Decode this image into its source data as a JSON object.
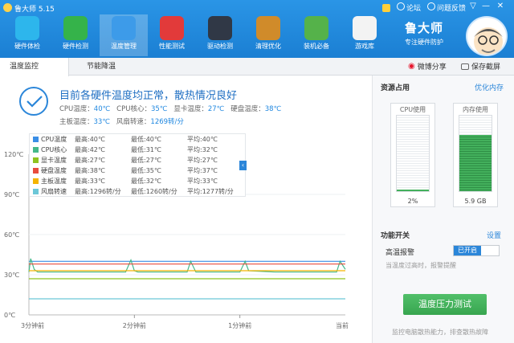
{
  "app": {
    "title": "鲁大师 5.15"
  },
  "top_links": {
    "forum": "论坛",
    "feedback": "问题反馈"
  },
  "toolbar": [
    {
      "label": "硬件体检",
      "icon": "monitor-icon",
      "color": "#2db6ec"
    },
    {
      "label": "硬件检测",
      "icon": "chip-icon",
      "color": "#35b34a"
    },
    {
      "label": "温度管理",
      "icon": "thermometer-chart-icon",
      "color": "#3d9be9"
    },
    {
      "label": "性能测试",
      "icon": "speedometer-icon",
      "color": "#e23a3a"
    },
    {
      "label": "驱动检测",
      "icon": "gear-icon",
      "color": "#303846"
    },
    {
      "label": "清理优化",
      "icon": "broom-icon",
      "color": "#d08b2a"
    },
    {
      "label": "装机必备",
      "icon": "box-icon",
      "color": "#55b24a"
    },
    {
      "label": "游戏库",
      "icon": "gamepad-icon",
      "color": "#f3f3f3"
    }
  ],
  "brand": {
    "name": "鲁大师",
    "subtitle": "专注硬件防护"
  },
  "tabs": [
    {
      "label": "温度监控",
      "active": true
    },
    {
      "label": "节能降温",
      "active": false
    }
  ],
  "actions": {
    "weibo_share": "微博分享",
    "save_screenshot": "保存截屏"
  },
  "summary": {
    "title": "目前各硬件温度均正常，散热情况良好",
    "metrics_row1": [
      {
        "label": "CPU温度：",
        "value": "40℃"
      },
      {
        "label": "CPU核心：",
        "value": "35℃"
      },
      {
        "label": "显卡温度：",
        "value": "27℃"
      },
      {
        "label": "硬盘温度：",
        "value": "38℃"
      }
    ],
    "metrics_row2": [
      {
        "label": "主板温度：",
        "value": "33℃"
      },
      {
        "label": "风扇转速：",
        "value": "1269转/分"
      }
    ]
  },
  "legend": [
    {
      "name": "CPU温度",
      "max": "最高:40℃",
      "min": "最低:40℃",
      "avg": "平均:40℃",
      "color": "#3a8ee6"
    },
    {
      "name": "CPU核心",
      "max": "最高:42℃",
      "min": "最低:31℃",
      "avg": "平均:32℃",
      "color": "#44b88a"
    },
    {
      "name": "显卡温度",
      "max": "最高:27℃",
      "min": "最低:27℃",
      "avg": "平均:27℃",
      "color": "#8fc31f"
    },
    {
      "name": "硬盘温度",
      "max": "最高:38℃",
      "min": "最低:35℃",
      "avg": "平均:37℃",
      "color": "#e84c3d"
    },
    {
      "name": "主板温度",
      "max": "最高:33℃",
      "min": "最低:32℃",
      "avg": "平均:33℃",
      "color": "#f5b400"
    },
    {
      "name": "风扇转速",
      "max": "最高:1296转/分",
      "min": "最低:1260转/分",
      "avg": "平均:1277转/分",
      "color": "#6cc7d8"
    }
  ],
  "chart_data": {
    "type": "line",
    "y_ticks": [
      "120℃",
      "90℃",
      "60℃",
      "30℃",
      "0℃"
    ],
    "x_ticks": [
      "3分钟前",
      "2分钟前",
      "1分钟前",
      "当前"
    ],
    "ylim": [
      0,
      120
    ],
    "x_range": [
      -180,
      0
    ],
    "series": [
      {
        "name": "CPU温度",
        "color": "#3a8ee6",
        "x": [
          -180,
          0
        ],
        "values": [
          40,
          40
        ]
      },
      {
        "name": "CPU核心",
        "color": "#44b88a",
        "x": [
          -180,
          -179,
          -177,
          -175,
          -125,
          -122,
          -120,
          -118,
          -90,
          -88,
          -85,
          -60,
          -57,
          -55,
          -40,
          -5,
          -3,
          0
        ],
        "values": [
          32,
          42,
          34,
          32,
          32,
          41,
          33,
          32,
          32,
          40,
          32,
          32,
          40,
          33,
          32,
          32,
          40,
          34
        ]
      },
      {
        "name": "显卡温度",
        "color": "#8fc31f",
        "x": [
          -180,
          0
        ],
        "values": [
          27,
          27
        ]
      },
      {
        "name": "硬盘温度",
        "color": "#e84c3d",
        "x": [
          -180,
          0
        ],
        "values": [
          38,
          38
        ]
      },
      {
        "name": "主板温度",
        "color": "#f5b400",
        "x": [
          -180,
          0
        ],
        "values": [
          33,
          33
        ]
      },
      {
        "name": "风扇转速",
        "color": "#6cc7d8",
        "x": [
          -180,
          0
        ],
        "values": [
          12,
          12
        ]
      }
    ]
  },
  "resources": {
    "title": "资源占用",
    "optimize_link": "优化内存",
    "cpu": {
      "label": "CPU使用",
      "value": "2%",
      "level": 0.02
    },
    "mem": {
      "label": "内存使用",
      "value": "5.9 GB",
      "level": 0.74
    }
  },
  "features": {
    "title": "功能开关",
    "settings_link": "设置",
    "alarm_label": "高温报警",
    "alarm_state": "已开启",
    "alarm_hint": "当温度过高时，报警提醒"
  },
  "stress_test": {
    "button": "温度压力测试",
    "hint": "监控电脑散热能力，排查散热故障"
  }
}
